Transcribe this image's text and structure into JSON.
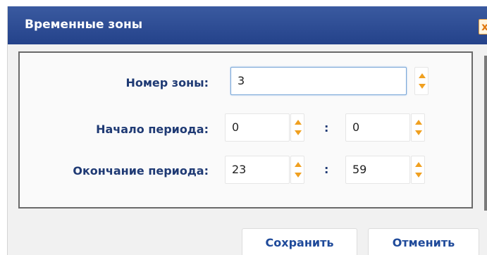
{
  "dialog": {
    "title": "Временные зоны",
    "close_label": "x"
  },
  "form": {
    "zone_number": {
      "label": "Номер зоны:",
      "value": "3"
    },
    "period_start": {
      "label": "Начало периода:",
      "hours": "0",
      "minutes": "0",
      "separator": ":"
    },
    "period_end": {
      "label": "Окончание периода:",
      "hours": "23",
      "minutes": "59",
      "separator": ":"
    }
  },
  "buttons": {
    "save": "Сохранить",
    "cancel": "Отменить"
  },
  "colors": {
    "title_bar": "#2d4b92",
    "accent": "#f0a020",
    "label_text": "#1f3a74"
  }
}
